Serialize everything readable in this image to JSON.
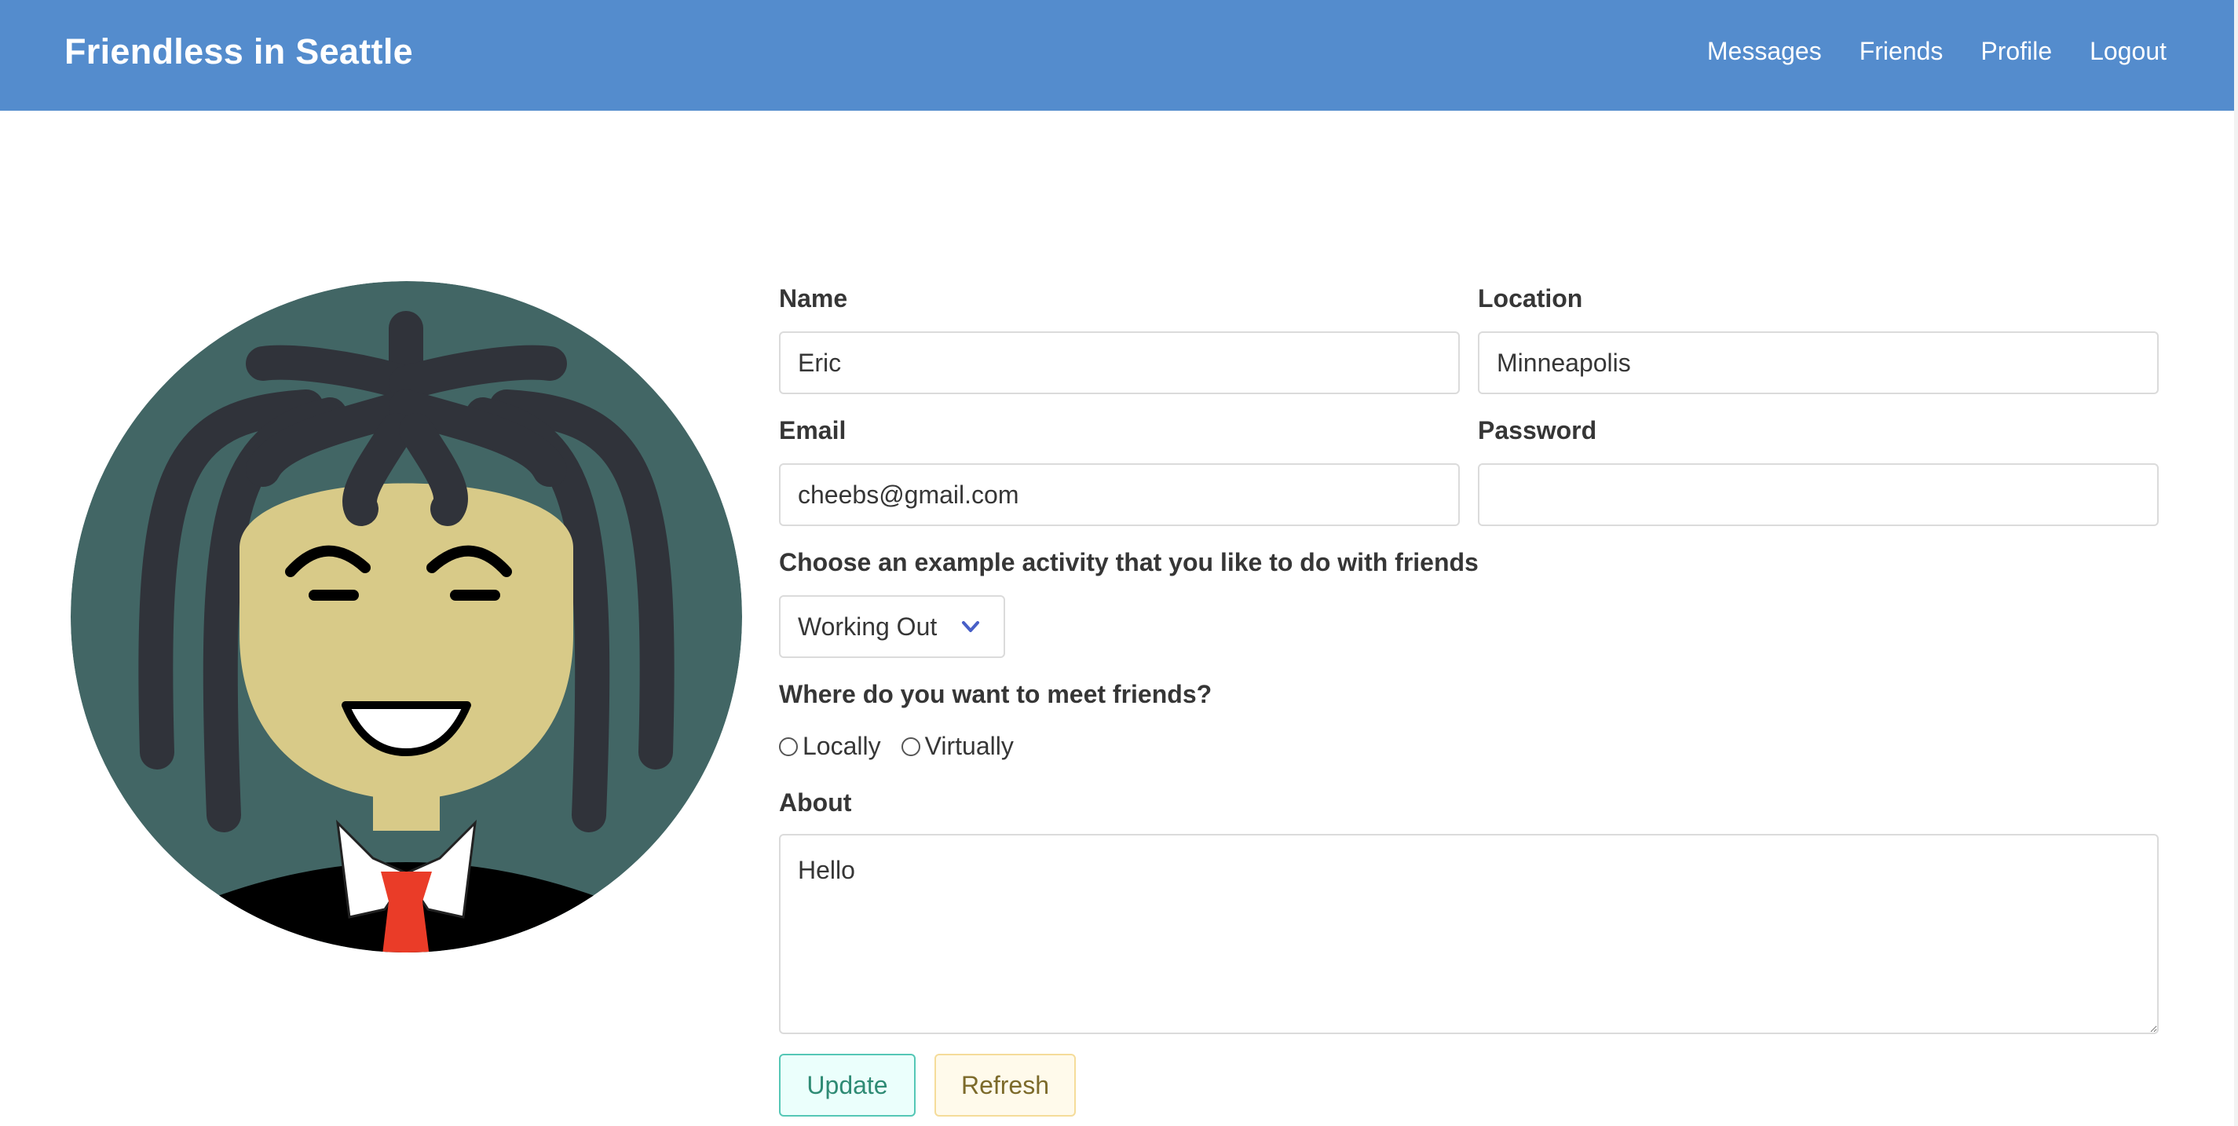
{
  "app": {
    "brand": "Friendless in Seattle"
  },
  "nav": {
    "items": [
      {
        "label": "Messages"
      },
      {
        "label": "Friends"
      },
      {
        "label": "Profile"
      },
      {
        "label": "Logout"
      }
    ]
  },
  "avatar": {
    "icon": "avatar-face"
  },
  "form": {
    "name": {
      "label": "Name",
      "value": "Eric"
    },
    "location": {
      "label": "Location",
      "value": "Minneapolis"
    },
    "email": {
      "label": "Email",
      "value": "cheebs@gmail.com"
    },
    "password": {
      "label": "Password",
      "value": ""
    },
    "activity": {
      "label": "Choose an example activity that you like to do with friends",
      "selected": "Working Out"
    },
    "meet": {
      "label": "Where do you want to meet friends?",
      "options": [
        {
          "label": "Locally"
        },
        {
          "label": "Virtually"
        }
      ]
    },
    "about": {
      "label": "About",
      "value": "Hello"
    },
    "buttons": {
      "update": "Update",
      "refresh": "Refresh"
    }
  },
  "colors": {
    "navbar": "#548ccd",
    "update_border": "#55c7b6",
    "refresh_border": "#f5dc9a",
    "chevron": "#485fc7"
  }
}
